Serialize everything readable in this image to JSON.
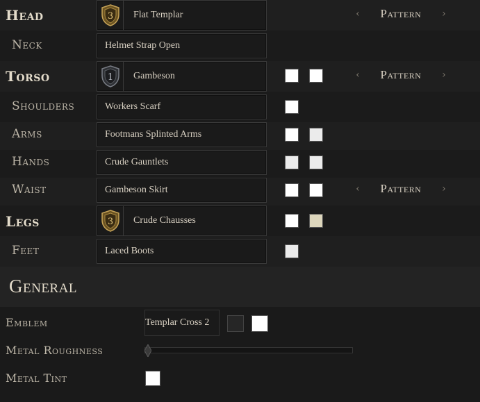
{
  "slots": {
    "head": {
      "label": "Head",
      "item": "Flat Templar",
      "tier": "3",
      "pattern": "Pattern"
    },
    "neck": {
      "label": "Neck",
      "item": "Helmet Strap Open"
    },
    "torso": {
      "label": "Torso",
      "item": "Gambeson",
      "tier": "1",
      "pattern": "Pattern"
    },
    "shoulders": {
      "label": "Shoulders",
      "item": "Workers Scarf"
    },
    "arms": {
      "label": "Arms",
      "item": "Footmans Splinted Arms"
    },
    "hands": {
      "label": "Hands",
      "item": "Crude Gauntlets"
    },
    "waist": {
      "label": "Waist",
      "item": "Gambeson Skirt",
      "pattern": "Pattern"
    },
    "legs": {
      "label": "Legs",
      "item": "Crude Chausses",
      "tier": "3"
    },
    "feet": {
      "label": "Feet",
      "item": "Laced Boots"
    }
  },
  "arrows": {
    "left": "‹",
    "right": "›"
  },
  "general": {
    "title": "General",
    "emblem_label": "Emblem",
    "emblem_value": "Templar Cross 2",
    "roughness_label": "Metal Roughness",
    "roughness_value": 0,
    "tint_label": "Metal Tint"
  },
  "colors": {
    "white": "#ffffff",
    "light_gray": "#ebebeb",
    "beige": "#ddd6bc",
    "dark_swatch": "#262626",
    "gold_badge": "#b08a3c",
    "silver_badge": "#5a5e64"
  }
}
